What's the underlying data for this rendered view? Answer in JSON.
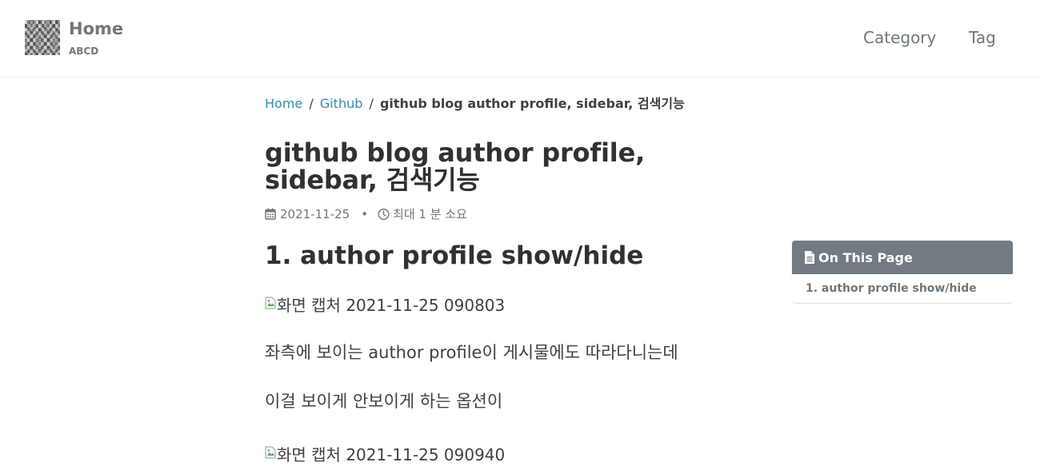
{
  "header": {
    "site_title": "Home",
    "site_subtitle": "ABCD",
    "nav": [
      "Category",
      "Tag"
    ]
  },
  "breadcrumb": {
    "items": [
      "Home",
      "Github"
    ],
    "separator": "/",
    "current": "github blog author profile, sidebar, 검색기능"
  },
  "post": {
    "title": "github blog author profile, sidebar, 검색기능",
    "date": "2021-11-25",
    "meta_separator": "•",
    "read_time": "최대 1 분 소요",
    "section_heading": "1. author profile show/hide",
    "image1_alt": "화면 캡처 2021-11-25 090803",
    "paragraph1": "좌측에 보이는 author profile이 게시물에도 따라다니는데",
    "paragraph2": "이걸 보이게 안보이게 하는 옵션이",
    "image2_alt": "화면 캡처 2021-11-25 090940"
  },
  "toc": {
    "title": "On This Page",
    "items": [
      "1. author profile show/hide"
    ]
  },
  "icons": {
    "logo": "pixelated-avatar-logo",
    "date": "calendar-icon",
    "read_time": "clock-icon",
    "toc": "file-text-icon",
    "broken_image": "broken-image-icon"
  },
  "colors": {
    "link": "#3a8ba8",
    "nav_text": "#6f777d",
    "toc_header_bg": "#727a82",
    "body_text": "#3d4144"
  }
}
